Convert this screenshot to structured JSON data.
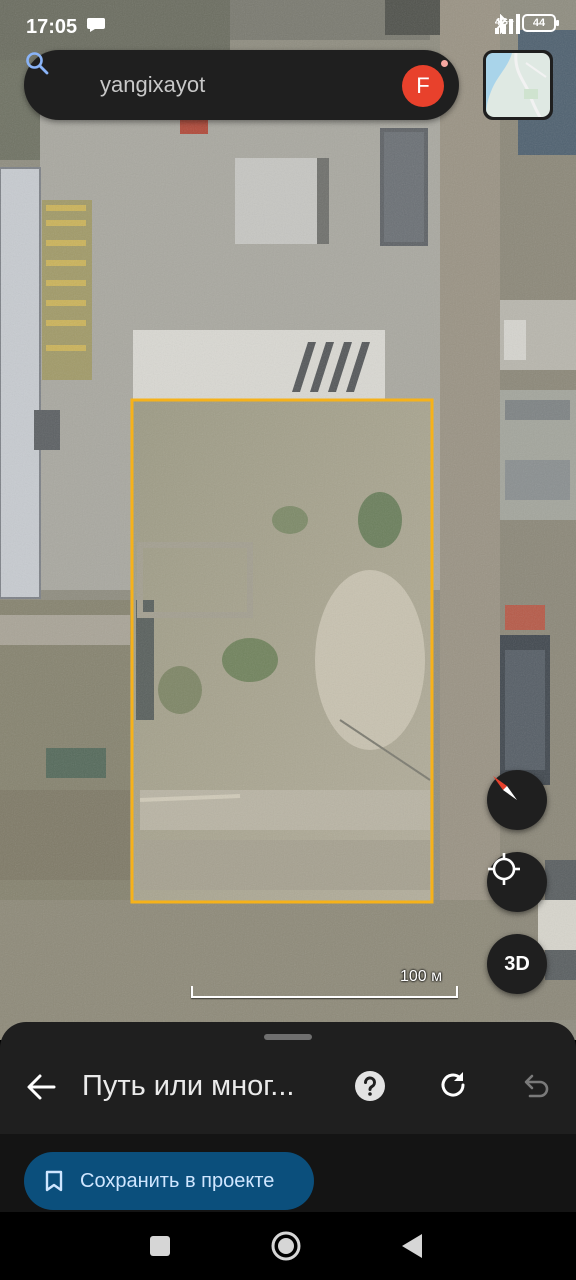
{
  "status_bar": {
    "time": "17:05",
    "network": "4G+",
    "battery": "44"
  },
  "search": {
    "query": "yangixayot",
    "avatar_letter": "F"
  },
  "map": {
    "type": "satellite",
    "scale_label": "100 м",
    "selection_color": "#f6b21a",
    "compass_button": "compass-icon",
    "locate_button": "crosshair-icon",
    "view_3d_label": "3D"
  },
  "sheet": {
    "title": "Путь или мног...",
    "save_label": "Сохранить в проекте",
    "accent_color": "#0b4f7c"
  },
  "nav": {
    "buttons": [
      "recents-square-icon",
      "home-circle-icon",
      "back-triangle-icon"
    ]
  }
}
